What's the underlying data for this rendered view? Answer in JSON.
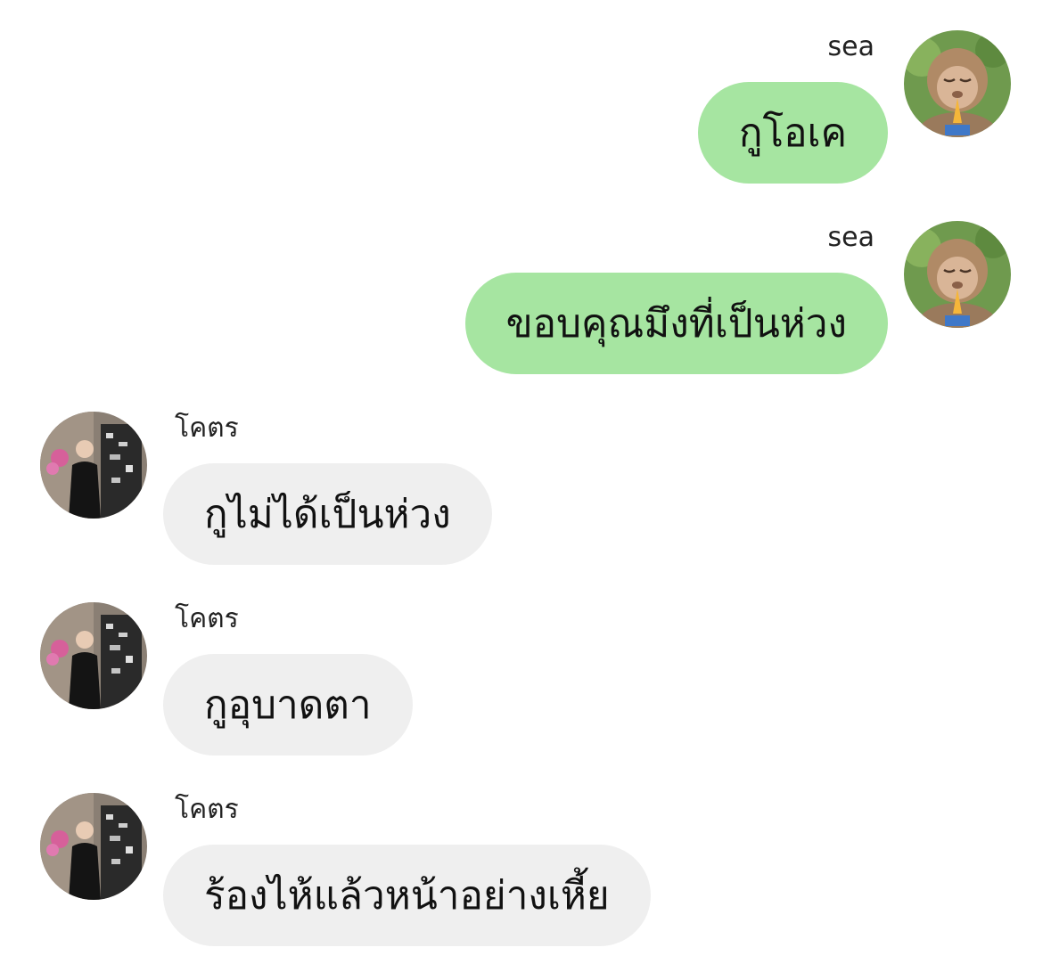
{
  "colors": {
    "outgoing_bubble": "#a6e5a1",
    "incoming_bubble": "#efefef",
    "text": "#111111"
  },
  "messages": [
    {
      "direction": "outgoing",
      "sender": "sea",
      "text": "กูโอเค",
      "avatar": "monkey-praying-avatar"
    },
    {
      "direction": "outgoing",
      "sender": "sea",
      "text": "ขอบคุณมึงที่เป็นห่วง",
      "avatar": "monkey-praying-avatar"
    },
    {
      "direction": "incoming",
      "sender": "โคตร",
      "text": "กูไม่ได้เป็นห่วง",
      "avatar": "person-photo-avatar"
    },
    {
      "direction": "incoming",
      "sender": "โคตร",
      "text": "กูอุบาดตา",
      "avatar": "person-photo-avatar"
    },
    {
      "direction": "incoming",
      "sender": "โคตร",
      "text": "ร้องไห้แล้วหน้าอย่างเหี้ย",
      "avatar": "person-photo-avatar"
    }
  ]
}
